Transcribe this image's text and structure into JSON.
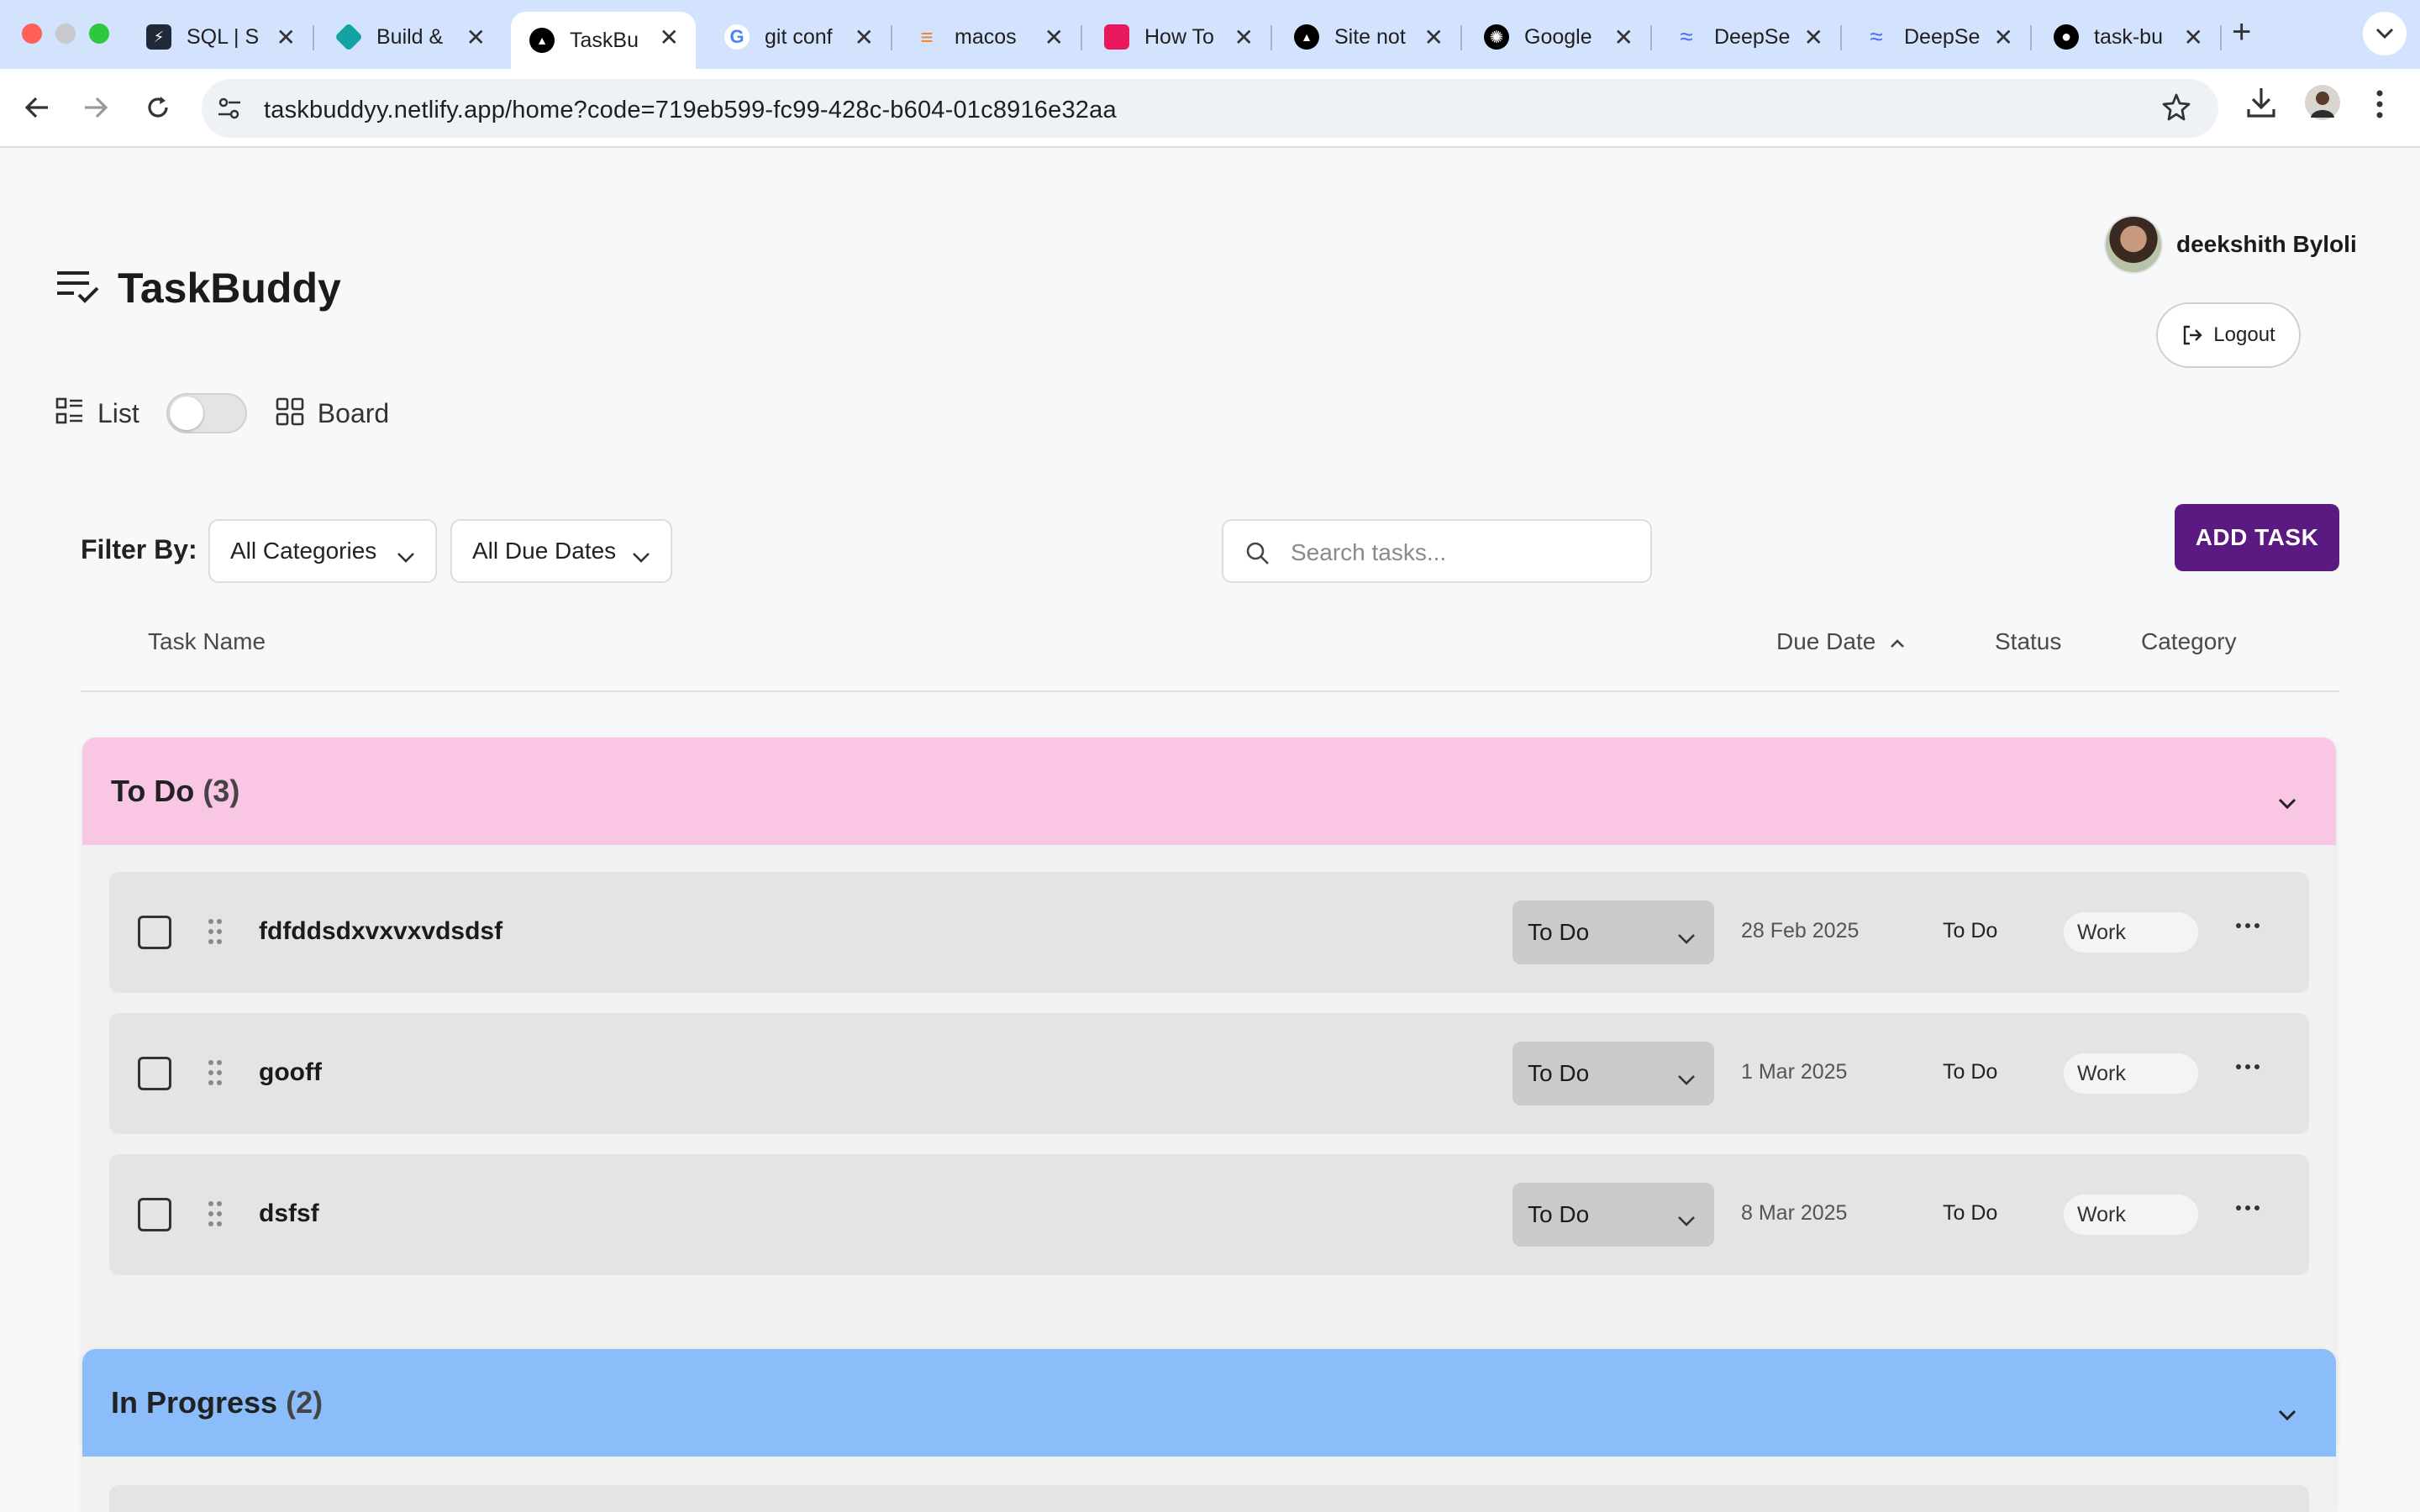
{
  "browser": {
    "tabs": [
      {
        "title": "SQL | S",
        "favicon_color": "#1f2937",
        "glyph": "⚡"
      },
      {
        "title": "Build &",
        "favicon_color": "#14a3a3",
        "glyph": "◆"
      },
      {
        "title": "TaskBu",
        "favicon_color": "#000000",
        "glyph": "▲",
        "active": true
      },
      {
        "title": "git conf",
        "favicon_color": "#ffffff",
        "glyph": "G"
      },
      {
        "title": "macos",
        "favicon_color": "#f48024",
        "glyph": "≡"
      },
      {
        "title": "How To",
        "favicon_color": "#e8195c",
        "glyph": "◆"
      },
      {
        "title": "Site not",
        "favicon_color": "#000000",
        "glyph": "▲"
      },
      {
        "title": "Google",
        "favicon_color": "#000000",
        "glyph": "✺"
      },
      {
        "title": "DeepSe",
        "favicon_color": "#4d6bfe",
        "glyph": "≈"
      },
      {
        "title": "DeepSe",
        "favicon_color": "#4d6bfe",
        "glyph": "≈"
      },
      {
        "title": "task-bu",
        "favicon_color": "#000000",
        "glyph": "●"
      }
    ],
    "url": "taskbuddyy.netlify.app/home?code=719eb599-fc99-428c-b604-01c8916e32aa"
  },
  "app": {
    "brand": "TaskBuddy",
    "user_name": "deekshith Byloli",
    "logout_label": "Logout",
    "view_list_label": "List",
    "view_board_label": "Board",
    "filter_label": "Filter By:",
    "category_filter": "All Categories",
    "due_filter": "All Due Dates",
    "search_placeholder": "Search tasks...",
    "add_task_label": "ADD TASK",
    "columns": {
      "task_name": "Task Name",
      "due_date": "Due Date",
      "status": "Status",
      "category": "Category"
    }
  },
  "sections": [
    {
      "title": "To Do",
      "count": "(3)",
      "color": "#f9c6e3",
      "tasks": [
        {
          "name": "fdfddsdxvxvxvdsdsf",
          "status_select": "To Do",
          "due": "28 Feb 2025",
          "status": "To Do",
          "category": "Work"
        },
        {
          "name": "gooff",
          "status_select": "To Do",
          "due": "1 Mar 2025",
          "status": "To Do",
          "category": "Work"
        },
        {
          "name": "dsfsf",
          "status_select": "To Do",
          "due": "8 Mar 2025",
          "status": "To Do",
          "category": "Work"
        }
      ]
    },
    {
      "title": "In Progress",
      "count": "(2)",
      "color": "#8abdf9",
      "tasks": []
    }
  ]
}
